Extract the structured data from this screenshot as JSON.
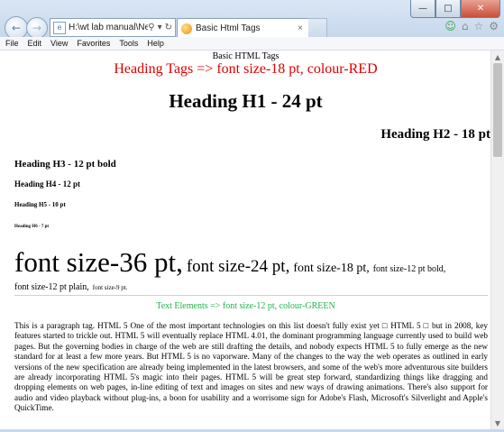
{
  "browser": {
    "address": "H:\\wt lab manual\\New folde",
    "tab_title": "Basic Html Tags",
    "tab_close": "×"
  },
  "menu": [
    "File",
    "Edit",
    "View",
    "Favorites",
    "Tools",
    "Help"
  ],
  "content": {
    "caption": "Basic HTML Tags",
    "heading_tags": "Heading Tags => font size-18 pt, colour-RED",
    "h1": "Heading H1 - 24 pt",
    "h2": "Heading H2 - 18 pt",
    "h3": "Heading H3 - 12 pt bold",
    "h4": "Heading H4 - 12 pt",
    "h5": "Heading H5 - 10 pt",
    "h6": "Heading H6 - 7 pt",
    "size36": "font size-36 pt,",
    "size24": "font size-24 pt,",
    "size18": "font size-18 pt,",
    "size12bold": "font size-12 pt bold,",
    "size12plain": "font size-12 pt plain,",
    "size9": "font size-9 pt.",
    "text_elements": "Text Elements => font size-12 pt, colour-GREEN",
    "paragraph": "This is a paragraph tag. HTML 5 One of the most important technologies on this list doesn't fully exist yet □ HTML 5 □ but in 2008, key features started to trickle out. HTML 5 will eventually replace HTML 4.01, the dominant programming language currently used to build web pages. But the governing bodies in charge of the web are still drafting the details, and nobody expects HTML 5 to fully emerge as the new standard for at least a few more years. But HTML 5 is no vaporware. Many of the changes to the way the web operates as outlined in early versions of the new specification are already being implemented in the latest browsers, and some of the web's more adventurous site builders are already incorporating HTML 5's magic into their pages. HTML 5 will be great step forward, standardizing things like dragging and dropping elements on web pages, in-line editing of text and images on sites and new ways of drawing animations. There's also support for audio and video playback without plug-ins, a boon for usability and a worrisome sign for Adobe's Flash, Microsoft's Silverlight and Apple's QuickTime."
  },
  "colors": {
    "red": "#e00000",
    "green": "#22b14c"
  },
  "icons": {
    "back": "back-arrow-icon",
    "forward": "forward-arrow-icon",
    "search": "search-icon",
    "refresh": "refresh-icon",
    "home": "home-icon",
    "favorites": "star-icon",
    "settings": "gear-icon"
  }
}
